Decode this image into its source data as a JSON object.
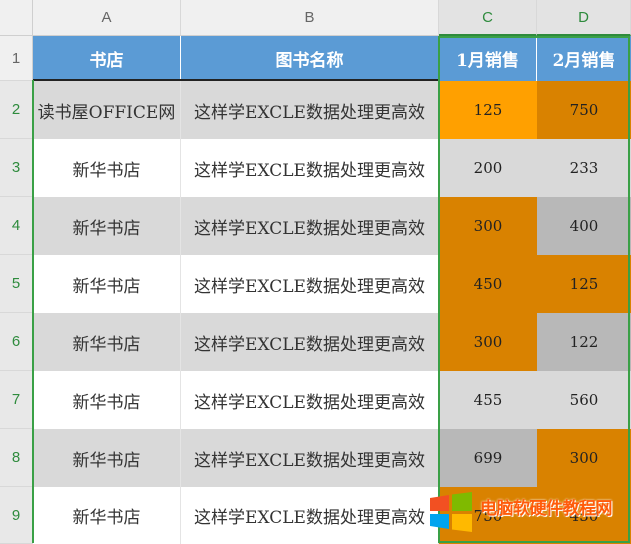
{
  "columns": [
    {
      "letter": "A",
      "selected": false
    },
    {
      "letter": "B",
      "selected": false
    },
    {
      "letter": "C",
      "selected": true
    },
    {
      "letter": "D",
      "selected": true
    }
  ],
  "header_row": {
    "number": "1",
    "cells": [
      "书店",
      "图书名称",
      "1月销售",
      "2月销售"
    ]
  },
  "rows": [
    {
      "number": "2",
      "store": "读书屋OFFICE网",
      "book": "这样学EXCLE数据处理更高效",
      "jan": "125",
      "feb": "750"
    },
    {
      "number": "3",
      "store": "新华书店",
      "book": "这样学EXCLE数据处理更高效",
      "jan": "200",
      "feb": "233"
    },
    {
      "number": "4",
      "store": "新华书店",
      "book": "这样学EXCLE数据处理更高效",
      "jan": "300",
      "feb": "400"
    },
    {
      "number": "5",
      "store": "新华书店",
      "book": "这样学EXCLE数据处理更高效",
      "jan": "450",
      "feb": "125"
    },
    {
      "number": "6",
      "store": "新华书店",
      "book": "这样学EXCLE数据处理更高效",
      "jan": "300",
      "feb": "122"
    },
    {
      "number": "7",
      "store": "新华书店",
      "book": "这样学EXCLE数据处理更高效",
      "jan": "455",
      "feb": "560"
    },
    {
      "number": "8",
      "store": "新华书店",
      "book": "这样学EXCLE数据处理更高效",
      "jan": "699",
      "feb": "300"
    },
    {
      "number": "9",
      "store": "新华书店",
      "book": "这样学EXCLE数据处理更高效",
      "jan": "750",
      "feb": "450"
    }
  ],
  "cell_fills": {
    "jan": [
      "#ffa000",
      "#d9d9d9",
      "#d98200",
      "#d98200",
      "#d98200",
      "#d9d9d9",
      "#b8b8b8",
      "#d98200"
    ],
    "feb": [
      "#d98200",
      "#d9d9d9",
      "#b8b8b8",
      "#d98200",
      "#b8b8b8",
      "#d9d9d9",
      "#d98200",
      "#d98200"
    ]
  },
  "colors": {
    "header_fill": "#5b9bd5",
    "band_gray": "#d9d9d9",
    "band_white": "#ffffff",
    "selection": "#3aa046"
  },
  "watermark": {
    "text": "电脑软硬件教程网",
    "icon": "windows-logo-icon"
  }
}
